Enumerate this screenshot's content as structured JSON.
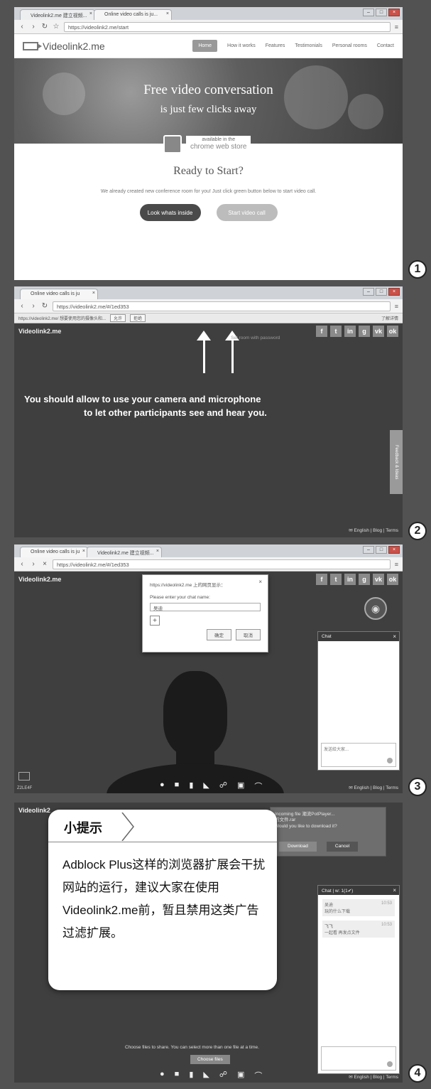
{
  "panel1": {
    "tabs": [
      "Videolink2.me 建立视频...",
      "Online video calls is ju..."
    ],
    "url": "https://videolink2.me/start",
    "logo": "Videolink2.me",
    "menu": [
      "Home",
      "How it works",
      "Features",
      "Testimonials",
      "Personal rooms",
      "Contact"
    ],
    "hero_title": "Free video conversation",
    "hero_subtitle": "is just few clicks away",
    "store_label": "available in the",
    "store_name": "chrome web store",
    "ready_title": "Ready to Start?",
    "ready_text": "We already created new conference room for you! Just click green button below to start video call.",
    "btn_inside": "Look whats inside",
    "btn_start": "Start video call",
    "step": "1"
  },
  "panel2": {
    "tab": "Online video calls is ju",
    "url": "https://videolink2.me/#/1ed353",
    "info_text": "https://videolink2.me/ 想要使用您的摄像头和...",
    "info_allow": "允许",
    "info_deny": "拒绝",
    "info_right": "了解详情",
    "app_title": "Videolink2.me",
    "small_hint": "Set room with password",
    "msg_line1": "You should allow to use your camera and microphone",
    "msg_line2": "to let other participants see and hear you.",
    "side_tab": "Feedback & Ideas",
    "footer": "✉ English | Blog | Terms",
    "step": "2"
  },
  "panel3": {
    "tabs": [
      "Online video calls is ju",
      "Videolink2.me 建立视频..."
    ],
    "url": "https://videolink2.me/#/1ed353",
    "app_title": "Videolink2.me",
    "dialog_title": "https://videolink2.me 上的网页显示：",
    "dialog_prompt": "Please enter your chat name:",
    "dialog_value": "吴迪",
    "dialog_ok": "确定",
    "dialog_cancel": "取消",
    "chat_title": "Chat",
    "chat_placeholder": "发送给大家...",
    "bottom_left": "Z2LE4F",
    "footer": "✉ English | Blog | Terms",
    "step": "3"
  },
  "panel4": {
    "app_title": "Videolink2",
    "dl_text1": "Incoming file 潮流PotPlayer...",
    "dl_text2": "的文件.rar",
    "dl_text3": "Would you like to download it?",
    "dl_download": "Download",
    "dl_cancel": "Cancel",
    "chat_title": "Chat | w: 1(1✔)",
    "msg1_name": "吴迪",
    "msg1_text": "玩的什么下载",
    "msg1_time": "10:53",
    "msg2_name": "飞飞",
    "msg2_text": "一起看 再发点文件",
    "msg2_time": "10:53",
    "share_hint": "Choose files to share. You can select more than one file at a time.",
    "choose_btn": "Choose files",
    "footer": "✉ English | Blog | Terms",
    "step": "4"
  },
  "tip": {
    "title": "小提示",
    "body": "Adblock Plus这样的浏览器扩展会干扰网站的运行，建议大家在使用Videolink2.me前，暂且禁用这类广告过滤扩展。"
  }
}
